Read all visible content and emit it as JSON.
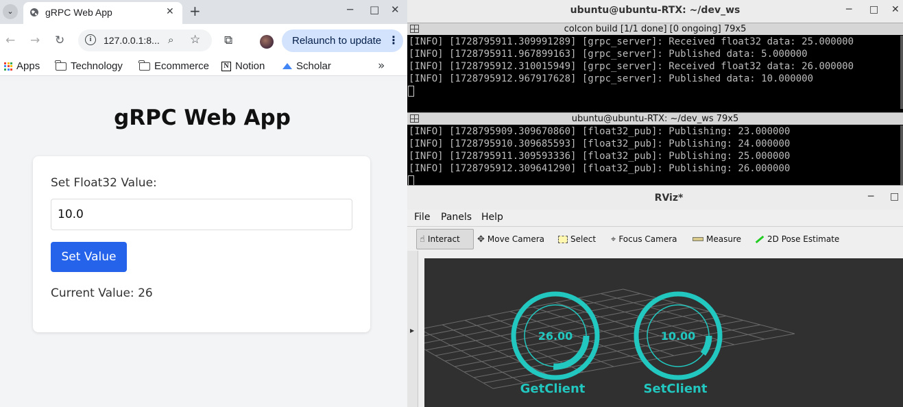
{
  "browser": {
    "tab_list_icon": "chevron-down-icon",
    "tab_title": "gRPC Web App",
    "url": "127.0.0.1:8...",
    "relaunch_label": "Relaunch to update",
    "bookmarks": [
      {
        "label": "Apps",
        "icon": "apps-grid-icon"
      },
      {
        "label": "Technology",
        "icon": "folder-icon"
      },
      {
        "label": "Ecommerce",
        "icon": "folder-icon"
      },
      {
        "label": "Notion",
        "icon": "notion-icon"
      },
      {
        "label": "Scholar",
        "icon": "scholar-icon"
      }
    ]
  },
  "app": {
    "title": "gRPC Web App",
    "input_label": "Set Float32 Value:",
    "input_value": "10.0",
    "button_label": "Set Value",
    "current_value_text": "Current Value: 26"
  },
  "terminal": {
    "title": "ubuntu@ubuntu-RTX: ~/dev_ws",
    "panes": [
      {
        "title": "colcon build [1/1 done] [0 ongoing] 79x5",
        "lines": [
          "[INFO] [1728795911.309991289] [grpc_server]: Received float32 data: 25.000000",
          "[INFO] [1728795911.967899163] [grpc_server]: Published data: 5.000000",
          "[INFO] [1728795912.310015949] [grpc_server]: Received float32 data: 26.000000",
          "[INFO] [1728795912.967917628] [grpc_server]: Published data: 10.000000"
        ]
      },
      {
        "title": "ubuntu@ubuntu-RTX: ~/dev_ws 79x5",
        "lines": [
          "[INFO] [1728795909.309670860] [float32_pub]: Publishing: 23.000000",
          "[INFO] [1728795910.309685593] [float32_pub]: Publishing: 24.000000",
          "[INFO] [1728795911.309593336] [float32_pub]: Publishing: 25.000000",
          "[INFO] [1728795912.309641290] [float32_pub]: Publishing: 26.000000"
        ]
      }
    ]
  },
  "rviz": {
    "title": "RViz*",
    "menu": [
      "File",
      "Panels",
      "Help"
    ],
    "tools": [
      "Interact",
      "Move Camera",
      "Select",
      "Focus Camera",
      "Measure",
      "2D Pose Estimate"
    ],
    "gauges": [
      {
        "value_text": "26.00",
        "label": "GetClient",
        "fill": 0.26
      },
      {
        "value_text": "10.00",
        "label": "SetClient",
        "fill": 0.1
      }
    ],
    "accent_color": "#22c7bf",
    "viewport_bg": "#303030"
  }
}
